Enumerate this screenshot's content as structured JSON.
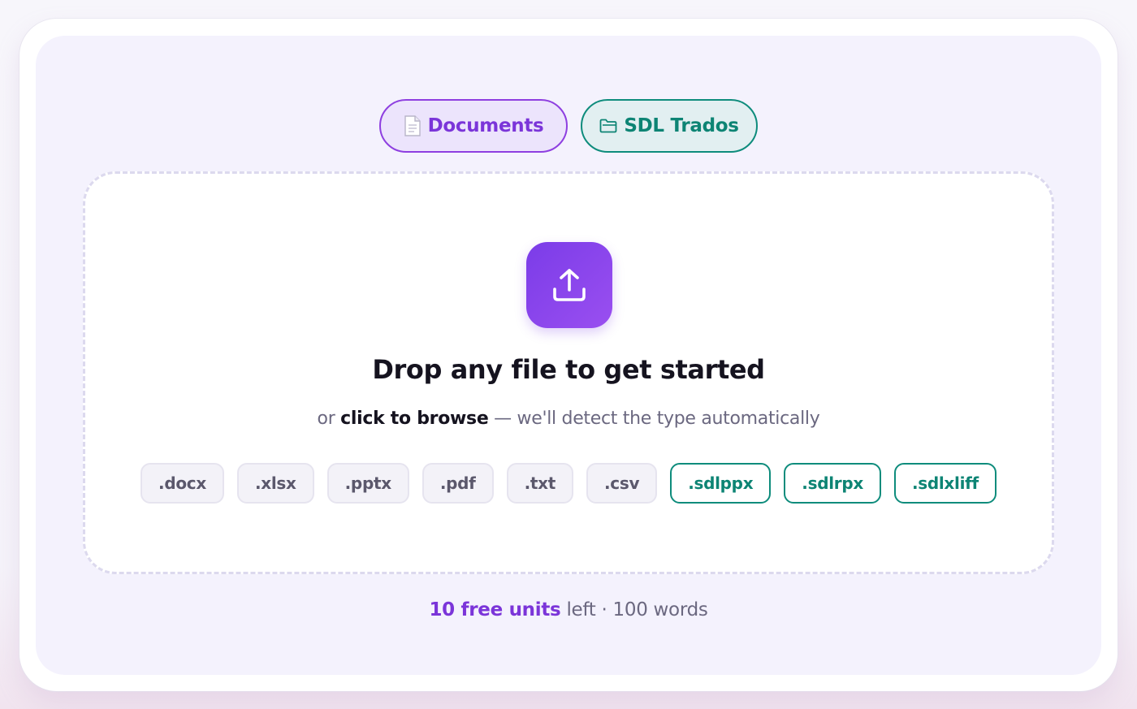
{
  "tabs": {
    "documents": {
      "icon": "document-icon",
      "label": "Documents"
    },
    "sdl": {
      "icon": "folder-icon",
      "label": "SDL Trados"
    }
  },
  "dropzone": {
    "upload_icon": "upload-icon",
    "headline": "Drop any file to get started",
    "sub_prefix": "or ",
    "sub_strong": "click to browse",
    "sub_suffix": " — we'll detect the type automatically"
  },
  "formats": {
    "standard": [
      ".docx",
      ".xlsx",
      ".pptx",
      ".pdf",
      ".txt",
      ".csv"
    ],
    "sdl": [
      ".sdlppx",
      ".sdlrpx",
      ".sdlxliff"
    ]
  },
  "footer": {
    "units_strong": "10 free units",
    "units_rest": " left · 100 words"
  },
  "colors": {
    "documents_accent": "#7b35d9",
    "sdl_accent": "#0d8474",
    "upload_bg": "#8645ec"
  }
}
